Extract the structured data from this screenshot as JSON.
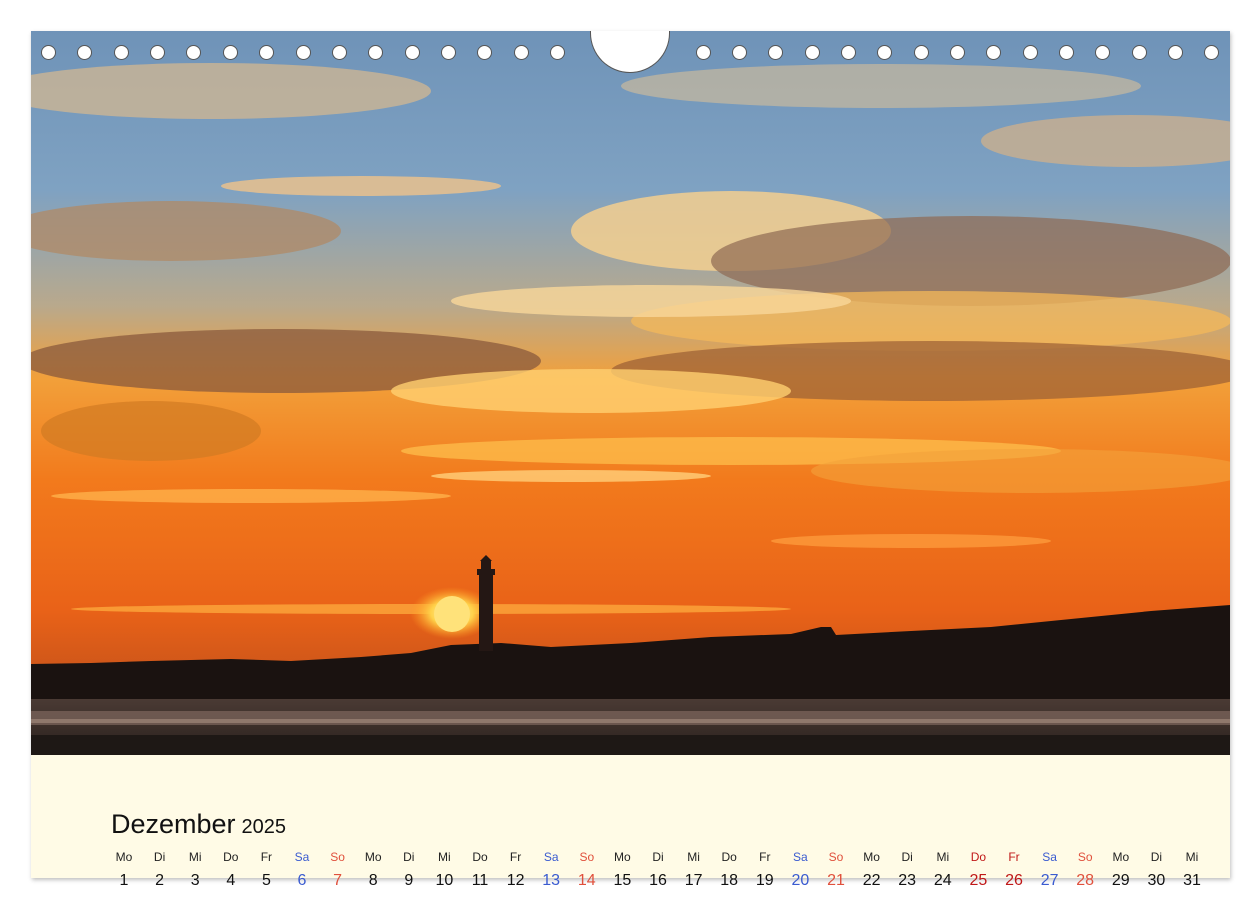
{
  "calendar": {
    "month": "Dezember",
    "year": "2025",
    "days": [
      {
        "dn": "Mo",
        "d": "1"
      },
      {
        "dn": "Di",
        "d": "2"
      },
      {
        "dn": "Mi",
        "d": "3"
      },
      {
        "dn": "Do",
        "d": "4"
      },
      {
        "dn": "Fr",
        "d": "5"
      },
      {
        "dn": "Sa",
        "d": "6"
      },
      {
        "dn": "So",
        "d": "7"
      },
      {
        "dn": "Mo",
        "d": "8"
      },
      {
        "dn": "Di",
        "d": "9"
      },
      {
        "dn": "Mi",
        "d": "10"
      },
      {
        "dn": "Do",
        "d": "11"
      },
      {
        "dn": "Fr",
        "d": "12"
      },
      {
        "dn": "Sa",
        "d": "13"
      },
      {
        "dn": "So",
        "d": "14"
      },
      {
        "dn": "Mo",
        "d": "15"
      },
      {
        "dn": "Di",
        "d": "16"
      },
      {
        "dn": "Mi",
        "d": "17"
      },
      {
        "dn": "Do",
        "d": "18"
      },
      {
        "dn": "Fr",
        "d": "19"
      },
      {
        "dn": "Sa",
        "d": "20"
      },
      {
        "dn": "So",
        "d": "21"
      },
      {
        "dn": "Mo",
        "d": "22"
      },
      {
        "dn": "Di",
        "d": "23"
      },
      {
        "dn": "Mi",
        "d": "24"
      },
      {
        "dn": "Do",
        "d": "25"
      },
      {
        "dn": "Fr",
        "d": "26"
      },
      {
        "dn": "Sa",
        "d": "27"
      },
      {
        "dn": "So",
        "d": "28"
      },
      {
        "dn": "Mo",
        "d": "29"
      },
      {
        "dn": "Di",
        "d": "30"
      },
      {
        "dn": "Mi",
        "d": "31"
      }
    ]
  },
  "colors": {
    "weekday": "#111111",
    "saturday": "#3a5bd0",
    "sunday": "#e0503c",
    "holiday": "#c01818",
    "page_background": "#fffbe6"
  }
}
